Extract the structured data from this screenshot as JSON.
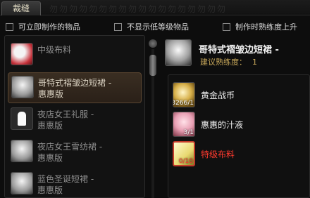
{
  "tab": {
    "label": "裁缝"
  },
  "header_deco": "勿勿勿勿勿勿勿勿勿勿勿勿勿勿勿勿勿勿",
  "filters": [
    {
      "label": "可立即制作的物品",
      "checked": false
    },
    {
      "label": "不显示低等级物品",
      "checked": false
    },
    {
      "label": "制作时熟练度上升",
      "checked": false
    }
  ],
  "recipes": [
    {
      "name": "中级布料",
      "icon": "fabric-icon",
      "selected": false
    },
    {
      "name": "哥特式褶皱边短裙 -\n惠惠版",
      "icon": "skirt-icon",
      "selected": true
    },
    {
      "name": "夜店女王礼服 -\n惠惠版",
      "icon": "dress-icon",
      "selected": false
    },
    {
      "name": "夜店女王雪纺裙 -\n惠惠版",
      "icon": "chiffon-skirt-icon",
      "selected": false
    },
    {
      "name": "蓝色圣诞短裙 -\n惠惠版",
      "icon": "christmas-skirt-icon",
      "selected": false
    }
  ],
  "detail": {
    "title": "哥特式褶皱边短裙 -",
    "skill_label": "建议熟练度：",
    "skill_value": "1"
  },
  "materials": [
    {
      "name": "黄金战币",
      "count": "3266/1",
      "icon": "gold-coin-icon",
      "sufficient": true
    },
    {
      "name": "惠惠的汁液",
      "count": "3/1",
      "icon": "juice-icon",
      "sufficient": true
    },
    {
      "name": "特级布料",
      "count": "0/10",
      "icon": "premium-fabric-icon",
      "sufficient": false
    }
  ],
  "colors": {
    "accent": "#c8a85a",
    "insufficient": "#ff3a2e"
  }
}
